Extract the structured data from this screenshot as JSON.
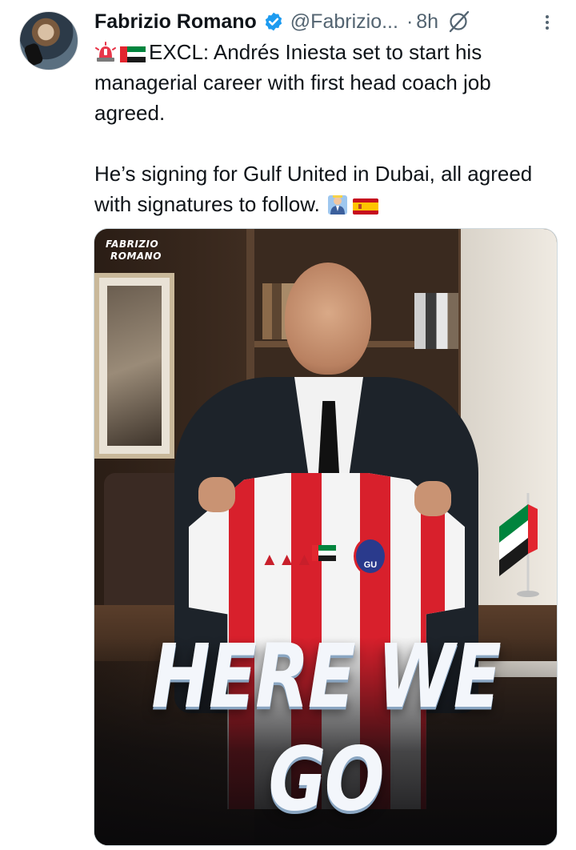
{
  "author": {
    "name": "Fabrizio Romano",
    "handle": "@Fabrizio...",
    "separator": "·",
    "time": "8h"
  },
  "icons": {
    "verified": "verified-badge-icon",
    "grok": "grok-icon",
    "more": "more-vertical-icon",
    "siren": "siren-emoji",
    "uae_flag": "uae-flag-emoji",
    "coach": "coach-emoji",
    "spain_flag": "spain-flag-emoji"
  },
  "colors": {
    "verified_blue": "#1d9bf0",
    "secondary_text": "#536471",
    "jersey_red": "#d8202c"
  },
  "tweet": {
    "line1": "EXCL: Andrés Iniesta set to start his managerial career with first head coach job agreed.",
    "line2": "He’s signing for Gulf United in Dubai, all agreed with signatures to follow."
  },
  "media": {
    "brand_line1": "FABRIZIO",
    "brand_line2": "ROMANO",
    "headline": "HERE WE GO",
    "crest_text": "GU"
  }
}
